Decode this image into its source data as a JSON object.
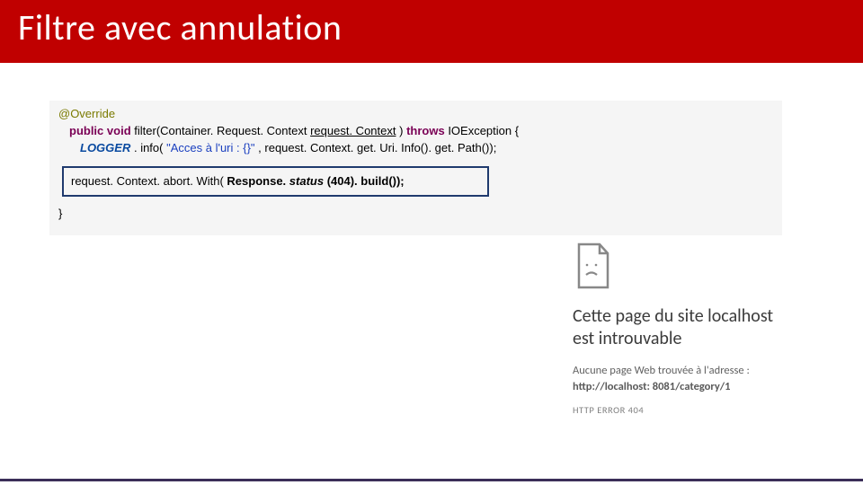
{
  "header": {
    "title": "Filtre avec annulation"
  },
  "code": {
    "annotation": "@Override",
    "kw_public": "public",
    "kw_void": "void",
    "method_sig_a": " filter(Container. Request. Context ",
    "param_name": "request. Context",
    "method_sig_b": ") ",
    "kw_throws": "throws",
    "method_sig_c": " IOException {",
    "logger": "LOGGER",
    "logger_call_a": ". info(",
    "string_lit": "\"Acces à l'uri :  {}\"",
    "logger_call_b": ", request. Context. get. Uri. Info(). get. Path());",
    "abort_a": "request. Context. abort. With(",
    "abort_resp": "Response. ",
    "abort_status": "status",
    "abort_b": "(404). build());",
    "close": "}"
  },
  "error": {
    "heading": "Cette page du site localhost est introuvable",
    "msg_prefix": "Aucune page Web trouvée à l'adresse : ",
    "msg_url": "http://localhost: 8081/category/1",
    "code": "HTTP ERROR 404"
  }
}
